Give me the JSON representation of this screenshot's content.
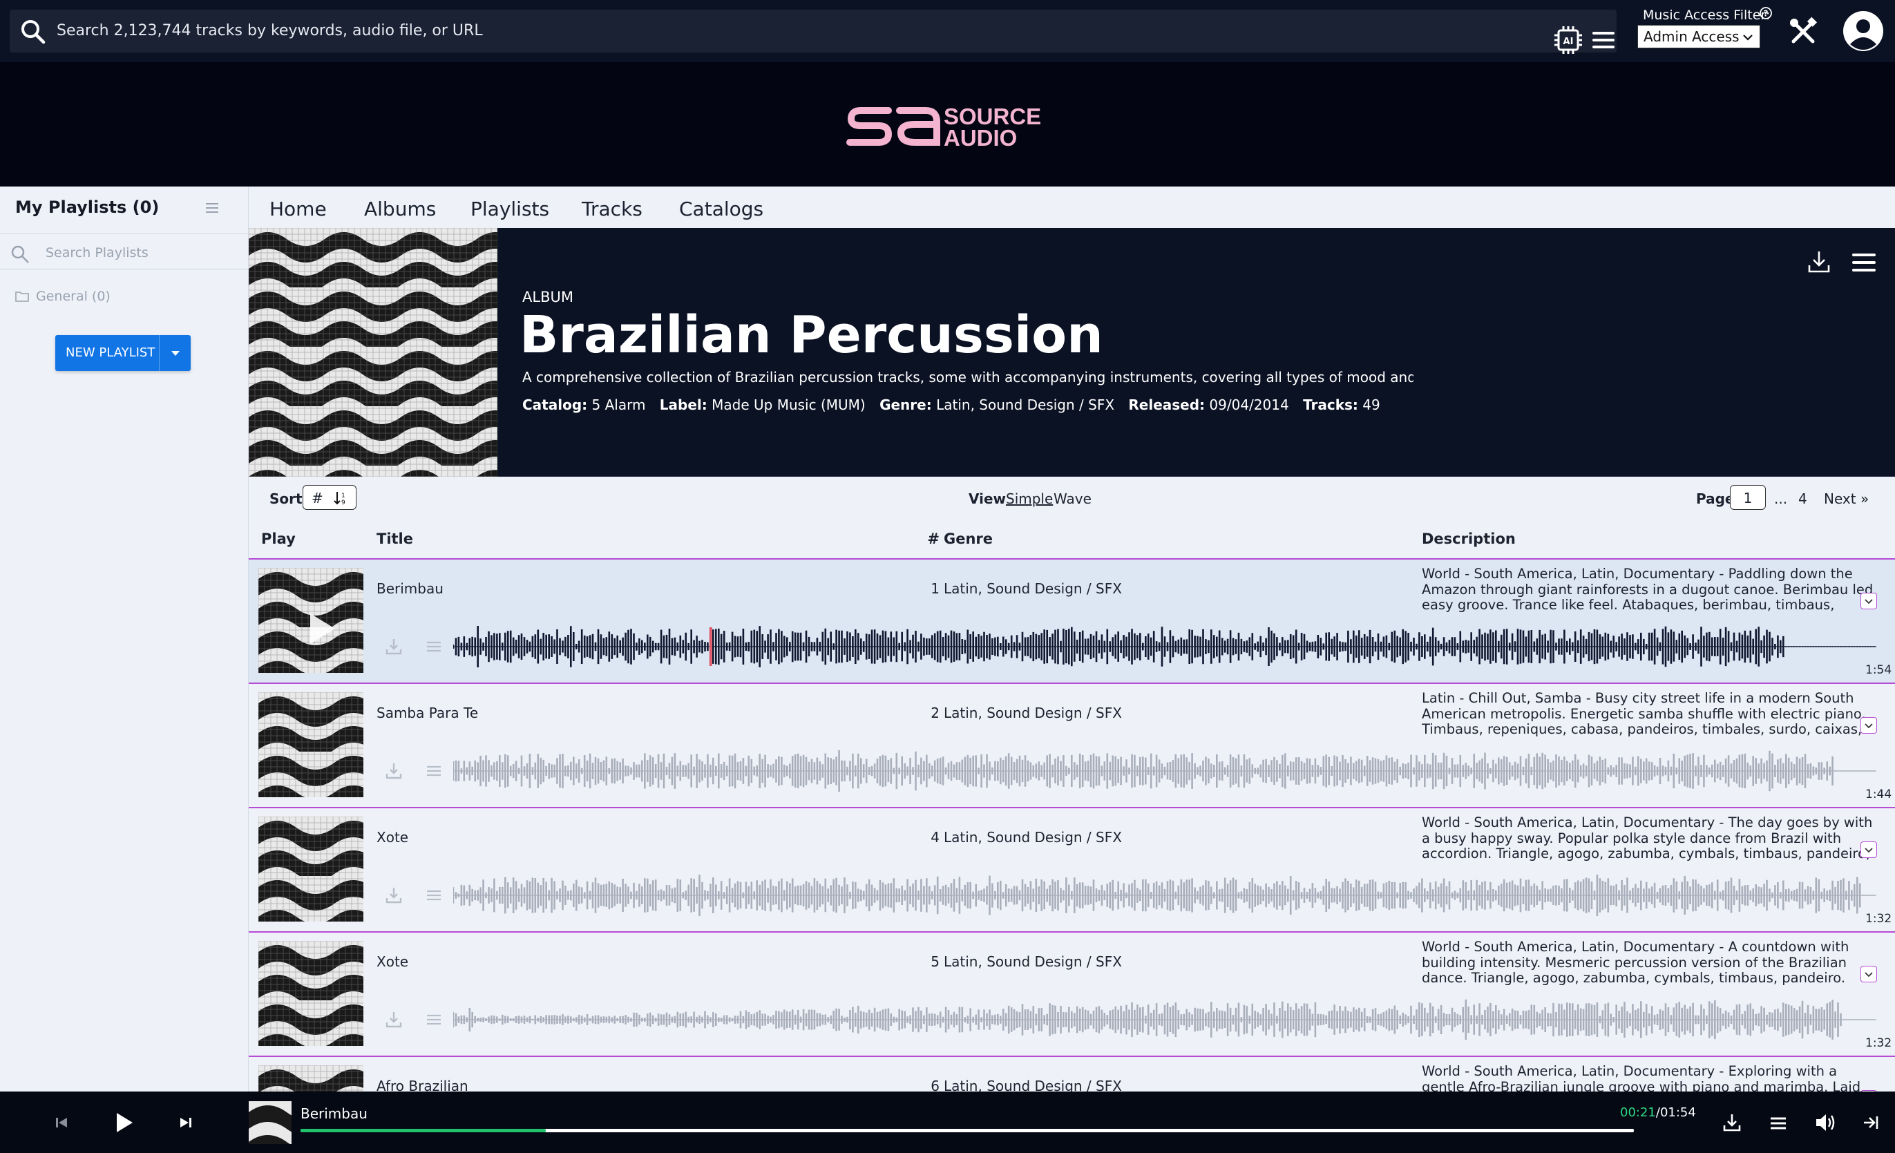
{
  "topbar": {
    "search_placeholder": "Search 2,123,744 tracks by keywords, audio file, or URL",
    "access_label": "Music Access Filter:",
    "access_value": "Admin Access"
  },
  "brand": {
    "line1": "SOURCE",
    "line2": "AUDIO",
    "color": "#f4b4cf"
  },
  "sidebar": {
    "title": "My Playlists (0)",
    "search_placeholder": "Search Playlists",
    "folder_label": "General (0)",
    "new_playlist_label": "NEW PLAYLIST"
  },
  "nav": {
    "tabs": [
      "Home",
      "Albums",
      "Playlists",
      "Tracks",
      "Catalogs"
    ]
  },
  "album": {
    "kind": "ALBUM",
    "title": "Brazilian Percussion",
    "description": "A comprehensive collection of Brazilian percussion tracks, some with accompanying instruments, covering all types of mood and rh",
    "meta": {
      "catalog_label": "Catalog:",
      "catalog": "5 Alarm",
      "label_label": "Label:",
      "label": "Made Up Music (MUM)",
      "genre_label": "Genre:",
      "genre": "Latin, Sound Design / SFX",
      "released_label": "Released:",
      "released": "09/04/2014",
      "tracks_label": "Tracks:",
      "tracks": "49"
    }
  },
  "toolbar": {
    "sort_label": "Sort",
    "sort_value": "#",
    "view_label": "View",
    "view_simple": "Simple",
    "view_wave": "Wave",
    "page_label": "Page",
    "page_current": "1",
    "page_ellipsis": "...",
    "page_last": "4",
    "next_label": "Next »"
  },
  "columns": {
    "play": "Play",
    "title": "Title",
    "num": "#",
    "genre": "Genre",
    "description": "Description"
  },
  "tracks": [
    {
      "title": "Berimbau",
      "num": "1",
      "genre": "Latin, Sound Design / SFX",
      "description": "World - South America, Latin, Documentary - Paddling down the Amazon through giant rainforests in a dugout canoe. Berimbau led easy groove. Trance like feel. Atabaques, berimbau, timbaus, talking drum,",
      "duration": "1:54",
      "active": true,
      "played_fraction": 0.18
    },
    {
      "title": "Samba Para Te",
      "num": "2",
      "genre": "Latin, Sound Design / SFX",
      "description": "Latin - Chill Out, Samba - Busy city street life in a modern South American metropolis. Energetic samba shuffle with electric piano. Timbaus, repeniques, cabasa, pandeiros, timbales, surdo, caixas,",
      "duration": "1:44",
      "active": false
    },
    {
      "title": "Xote",
      "num": "4",
      "genre": "Latin, Sound Design / SFX",
      "description": "World - South America, Latin, Documentary - The day goes by with a busy happy sway. Popular polka style dance from Brazil with accordion. Triangle, agogo, zabumba, cymbals, timbaus, pandeiro, accordion, bass",
      "duration": "1:32",
      "active": false
    },
    {
      "title": "Xote",
      "num": "5",
      "genre": "Latin, Sound Design / SFX",
      "description": "World - South America, Latin, Documentary - A countdown with building intensity. Mesmeric percussion version of the Brazilian dance. Triangle, agogo, zabumba, cymbals, timbaus, pandeiro. Rhythmic, World, Groovy",
      "duration": "1:32",
      "active": false
    },
    {
      "title": "Afro Brazilian",
      "num": "6",
      "genre": "Latin, Sound Design / SFX",
      "description": "World - South America, Latin, Documentary - Exploring with a gentle Afro-Brazilian jungle groove with piano and marimba. Laid back but",
      "duration": "",
      "active": false
    }
  ],
  "player": {
    "title": "Berimbau",
    "current": "00:21",
    "total": "/01:54",
    "progress": 0.184,
    "accent": "#21c26e"
  },
  "colors": {
    "divider": "#b64bd6",
    "primary": "#1275e6",
    "header": "#0b1224"
  }
}
